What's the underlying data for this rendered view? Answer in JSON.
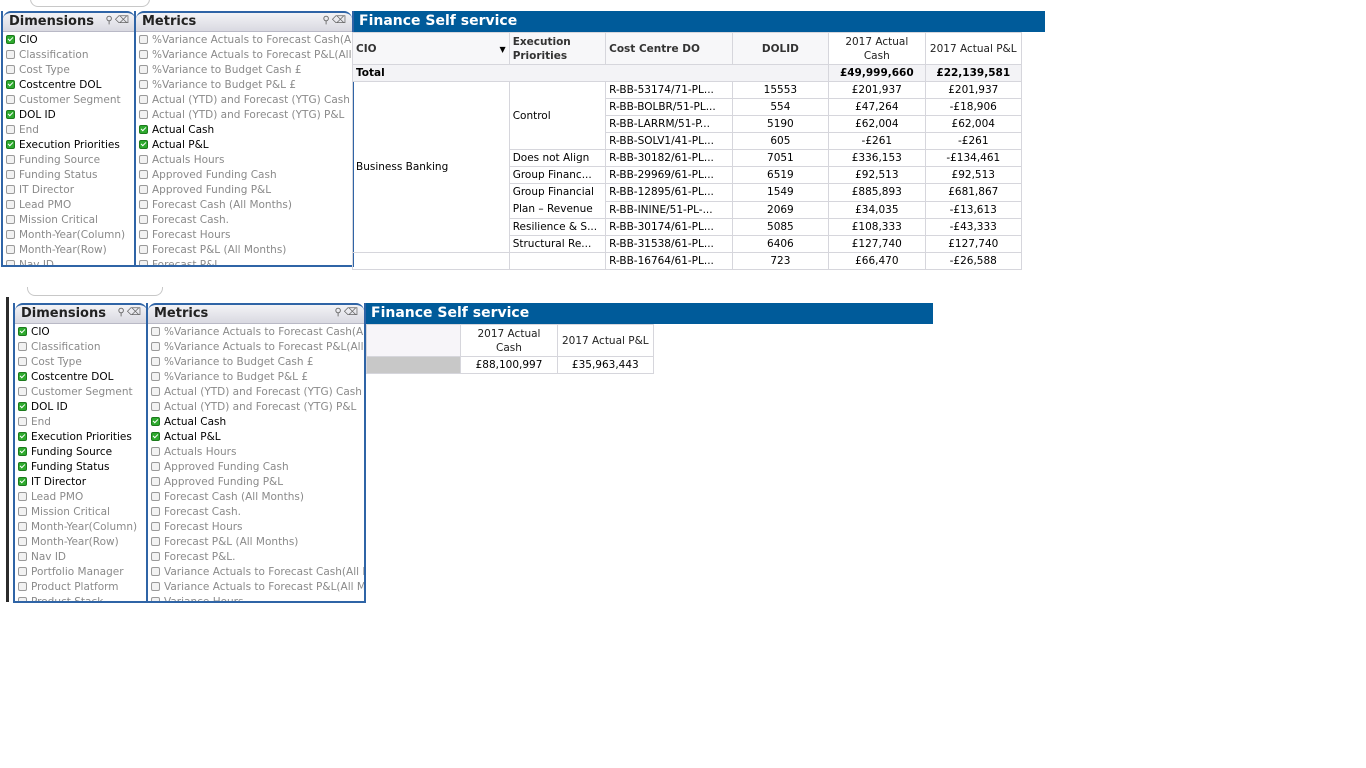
{
  "top": {
    "dimensions": {
      "title": "Dimensions",
      "items": [
        {
          "label": "CIO",
          "checked": true
        },
        {
          "label": "Classification",
          "checked": false
        },
        {
          "label": "Cost Type",
          "checked": false
        },
        {
          "label": "Costcentre DOL",
          "checked": true
        },
        {
          "label": "Customer Segment",
          "checked": false
        },
        {
          "label": "DOL ID",
          "checked": true
        },
        {
          "label": "End",
          "checked": false
        },
        {
          "label": "Execution Priorities",
          "checked": true
        },
        {
          "label": "Funding Source",
          "checked": false
        },
        {
          "label": "Funding Status",
          "checked": false
        },
        {
          "label": "IT Director",
          "checked": false
        },
        {
          "label": "Lead PMO",
          "checked": false
        },
        {
          "label": "Mission Critical",
          "checked": false
        },
        {
          "label": "Month-Year(Column)",
          "checked": false
        },
        {
          "label": "Month-Year(Row)",
          "checked": false
        },
        {
          "label": "Nav ID",
          "checked": false
        }
      ]
    },
    "metrics": {
      "title": "Metrics",
      "items": [
        {
          "label": "%Variance Actuals to Forecast Cash(All Months)",
          "checked": false
        },
        {
          "label": "%Variance Actuals to Forecast P&L(All Months)",
          "checked": false
        },
        {
          "label": "%Variance to Budget Cash £",
          "checked": false
        },
        {
          "label": "%Variance to Budget P&L £",
          "checked": false
        },
        {
          "label": "Actual (YTD) and Forecast (YTG) Cash",
          "checked": false
        },
        {
          "label": "Actual (YTD) and Forecast (YTG) P&L",
          "checked": false
        },
        {
          "label": "Actual Cash",
          "checked": true
        },
        {
          "label": "Actual P&L",
          "checked": true
        },
        {
          "label": "Actuals Hours",
          "checked": false
        },
        {
          "label": "Approved Funding Cash",
          "checked": false
        },
        {
          "label": "Approved Funding P&L",
          "checked": false
        },
        {
          "label": "Forecast Cash (All Months)",
          "checked": false
        },
        {
          "label": "Forecast Cash.",
          "checked": false
        },
        {
          "label": "Forecast Hours",
          "checked": false
        },
        {
          "label": "Forecast P&L (All Months)",
          "checked": false
        },
        {
          "label": "Forecast P&L.",
          "checked": false
        }
      ]
    },
    "table": {
      "title": "Finance Self service",
      "headers": [
        "CIO",
        "Execution Priorities",
        "Cost Centre DO",
        "DOLID",
        "2017 Actual Cash",
        "2017 Actual P&L"
      ],
      "total": {
        "label": "Total",
        "cash": "£49,999,660",
        "pl": "£22,139,581"
      },
      "cio_group": "Business Banking",
      "rows": [
        {
          "priority": "Control",
          "cc": "R-BB-53174/71-PL...",
          "dolid": "15553",
          "cash": "£201,937",
          "pl": "£201,937"
        },
        {
          "priority": "",
          "cc": "R-BB-BOLBR/51-PL...",
          "dolid": "554",
          "cash": "£47,264",
          "pl": "-£18,906"
        },
        {
          "priority": "",
          "cc": "R-BB-LARRM/51-P...",
          "dolid": "5190",
          "cash": "£62,004",
          "pl": "£62,004"
        },
        {
          "priority": "",
          "cc": "R-BB-SOLV1/41-PL...",
          "dolid": "605",
          "cash": "-£261",
          "pl": "-£261"
        },
        {
          "priority": "Does not Align",
          "cc": "R-BB-30182/61-PL...",
          "dolid": "7051",
          "cash": "£336,153",
          "pl": "-£134,461"
        },
        {
          "priority": "Group Financ...",
          "cc": "R-BB-29969/61-PL...",
          "dolid": "6519",
          "cash": "£92,513",
          "pl": "£92,513"
        },
        {
          "priority": "Group Financial Plan – Revenue",
          "cc": "R-BB-12895/61-PL...",
          "dolid": "1549",
          "cash": "£885,893",
          "pl": "£681,867"
        },
        {
          "priority": "",
          "cc": "R-BB-ININE/51-PL-...",
          "dolid": "2069",
          "cash": "£34,035",
          "pl": "-£13,613"
        },
        {
          "priority": "Resilience & S...",
          "cc": "R-BB-30174/61-PL...",
          "dolid": "5085",
          "cash": "£108,333",
          "pl": "-£43,333"
        },
        {
          "priority": "Structural Re...",
          "cc": "R-BB-31538/61-PL...",
          "dolid": "6406",
          "cash": "£127,740",
          "pl": "£127,740"
        },
        {
          "priority": "",
          "cc": "R-BB-16764/61-PL...",
          "dolid": "723",
          "cash": "£66,470",
          "pl": "-£26,588"
        }
      ]
    }
  },
  "bottom": {
    "dimensions": {
      "title": "Dimensions",
      "items": [
        {
          "label": "CIO",
          "checked": true
        },
        {
          "label": "Classification",
          "checked": false
        },
        {
          "label": "Cost Type",
          "checked": false
        },
        {
          "label": "Costcentre DOL",
          "checked": true
        },
        {
          "label": "Customer Segment",
          "checked": false
        },
        {
          "label": "DOL ID",
          "checked": true
        },
        {
          "label": "End",
          "checked": false
        },
        {
          "label": "Execution Priorities",
          "checked": true
        },
        {
          "label": "Funding Source",
          "checked": true
        },
        {
          "label": "Funding Status",
          "checked": true
        },
        {
          "label": "IT Director",
          "checked": true
        },
        {
          "label": "Lead PMO",
          "checked": false
        },
        {
          "label": "Mission Critical",
          "checked": false
        },
        {
          "label": "Month-Year(Column)",
          "checked": false
        },
        {
          "label": "Month-Year(Row)",
          "checked": false
        },
        {
          "label": "Nav ID",
          "checked": false
        },
        {
          "label": "Portfolio Manager",
          "checked": false
        },
        {
          "label": "Product Platform",
          "checked": false
        },
        {
          "label": "Product Stack",
          "checked": false
        }
      ]
    },
    "metrics": {
      "title": "Metrics",
      "items": [
        {
          "label": "%Variance Actuals to Forecast Cash(All Months)",
          "checked": false
        },
        {
          "label": "%Variance Actuals to Forecast P&L(All Months)",
          "checked": false
        },
        {
          "label": "%Variance to Budget Cash £",
          "checked": false
        },
        {
          "label": "%Variance to Budget P&L £",
          "checked": false
        },
        {
          "label": "Actual (YTD) and Forecast (YTG) Cash",
          "checked": false
        },
        {
          "label": "Actual (YTD) and Forecast (YTG) P&L",
          "checked": false
        },
        {
          "label": "Actual Cash",
          "checked": true
        },
        {
          "label": "Actual P&L",
          "checked": true
        },
        {
          "label": "Actuals Hours",
          "checked": false
        },
        {
          "label": "Approved Funding Cash",
          "checked": false
        },
        {
          "label": "Approved Funding P&L",
          "checked": false
        },
        {
          "label": "Forecast Cash (All Months)",
          "checked": false
        },
        {
          "label": "Forecast Cash.",
          "checked": false
        },
        {
          "label": "Forecast Hours",
          "checked": false
        },
        {
          "label": "Forecast P&L (All Months)",
          "checked": false
        },
        {
          "label": "Forecast P&L.",
          "checked": false
        },
        {
          "label": "Variance Actuals to Forecast Cash(All Months)",
          "checked": false
        },
        {
          "label": "Variance Actuals to Forecast P&L(All Months)",
          "checked": false
        },
        {
          "label": "Variance Hours",
          "checked": false
        }
      ]
    },
    "table": {
      "title": "Finance Self service",
      "headers": [
        "2017 Actual Cash",
        "2017 Actual P&L"
      ],
      "values": {
        "cash": "£88,100,997",
        "pl": "£35,963,443"
      }
    }
  },
  "icons": {
    "search": "search-icon",
    "clear": "eraser-icon",
    "sort": "sort-down-icon"
  }
}
